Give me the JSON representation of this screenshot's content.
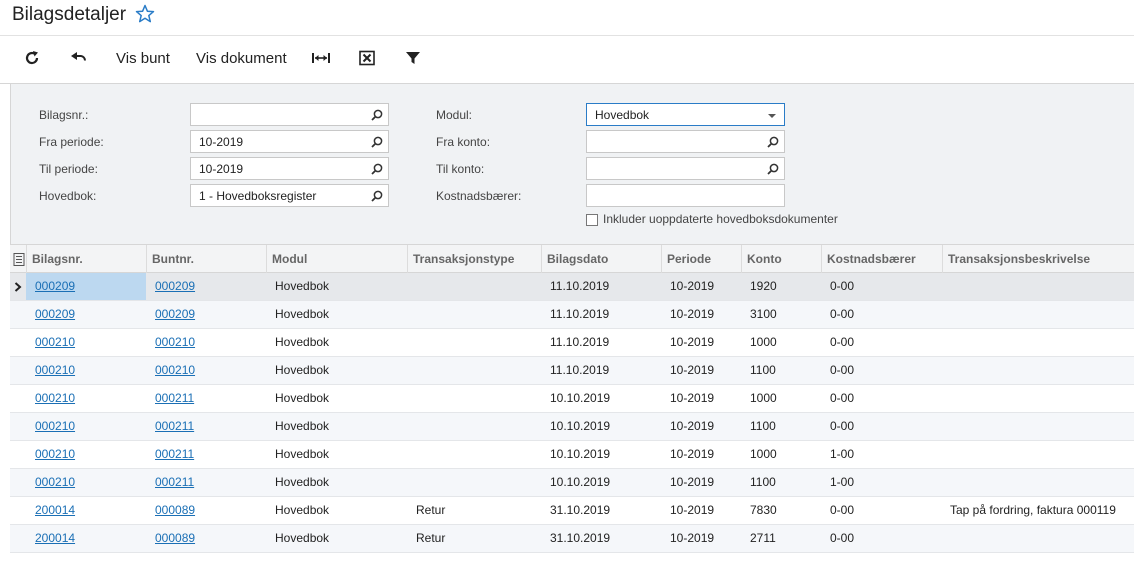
{
  "page": {
    "title": "Bilagsdetaljer"
  },
  "toolbar": {
    "vis_bunt": "Vis bunt",
    "vis_dokument": "Vis dokument"
  },
  "filter": {
    "bilagsnr_label": "Bilagsnr.:",
    "bilagsnr_value": "",
    "fra_periode_label": "Fra periode:",
    "fra_periode_value": "10-2019",
    "til_periode_label": "Til periode:",
    "til_periode_value": "10-2019",
    "hovedbok_label": "Hovedbok:",
    "hovedbok_value": "1 - Hovedboksregister",
    "modul_label": "Modul:",
    "modul_value": "Hovedbok",
    "fra_konto_label": "Fra konto:",
    "fra_konto_value": "",
    "til_konto_label": "Til konto:",
    "til_konto_value": "",
    "kostnadsbaerer_label": "Kostnadsbærer:",
    "kostnadsbaerer_value": "",
    "include_label": "Inkluder uoppdaterte hovedboksdokumenter"
  },
  "grid": {
    "columns": [
      "Bilagsnr.",
      "Buntnr.",
      "Modul",
      "Transaksjonstype",
      "Bilagsdato",
      "Periode",
      "Konto",
      "Kostnadsbærer",
      "Transaksjonsbeskrivelse"
    ],
    "rows": [
      [
        "000209",
        "000209",
        "Hovedbok",
        "",
        "11.10.2019",
        "10-2019",
        "1920",
        "0-00",
        ""
      ],
      [
        "000209",
        "000209",
        "Hovedbok",
        "",
        "11.10.2019",
        "10-2019",
        "3100",
        "0-00",
        ""
      ],
      [
        "000210",
        "000210",
        "Hovedbok",
        "",
        "11.10.2019",
        "10-2019",
        "1000",
        "0-00",
        ""
      ],
      [
        "000210",
        "000210",
        "Hovedbok",
        "",
        "11.10.2019",
        "10-2019",
        "1100",
        "0-00",
        ""
      ],
      [
        "000210",
        "000211",
        "Hovedbok",
        "",
        "10.10.2019",
        "10-2019",
        "1000",
        "0-00",
        ""
      ],
      [
        "000210",
        "000211",
        "Hovedbok",
        "",
        "10.10.2019",
        "10-2019",
        "1100",
        "0-00",
        ""
      ],
      [
        "000210",
        "000211",
        "Hovedbok",
        "",
        "10.10.2019",
        "10-2019",
        "1000",
        "1-00",
        ""
      ],
      [
        "000210",
        "000211",
        "Hovedbok",
        "",
        "10.10.2019",
        "10-2019",
        "1100",
        "1-00",
        ""
      ],
      [
        "200014",
        "000089",
        "Hovedbok",
        "Retur",
        "31.10.2019",
        "10-2019",
        "7830",
        "0-00",
        "Tap på fordring, faktura 000119"
      ],
      [
        "200014",
        "000089",
        "Hovedbok",
        "Retur",
        "31.10.2019",
        "10-2019",
        "2711",
        "0-00",
        ""
      ]
    ]
  }
}
